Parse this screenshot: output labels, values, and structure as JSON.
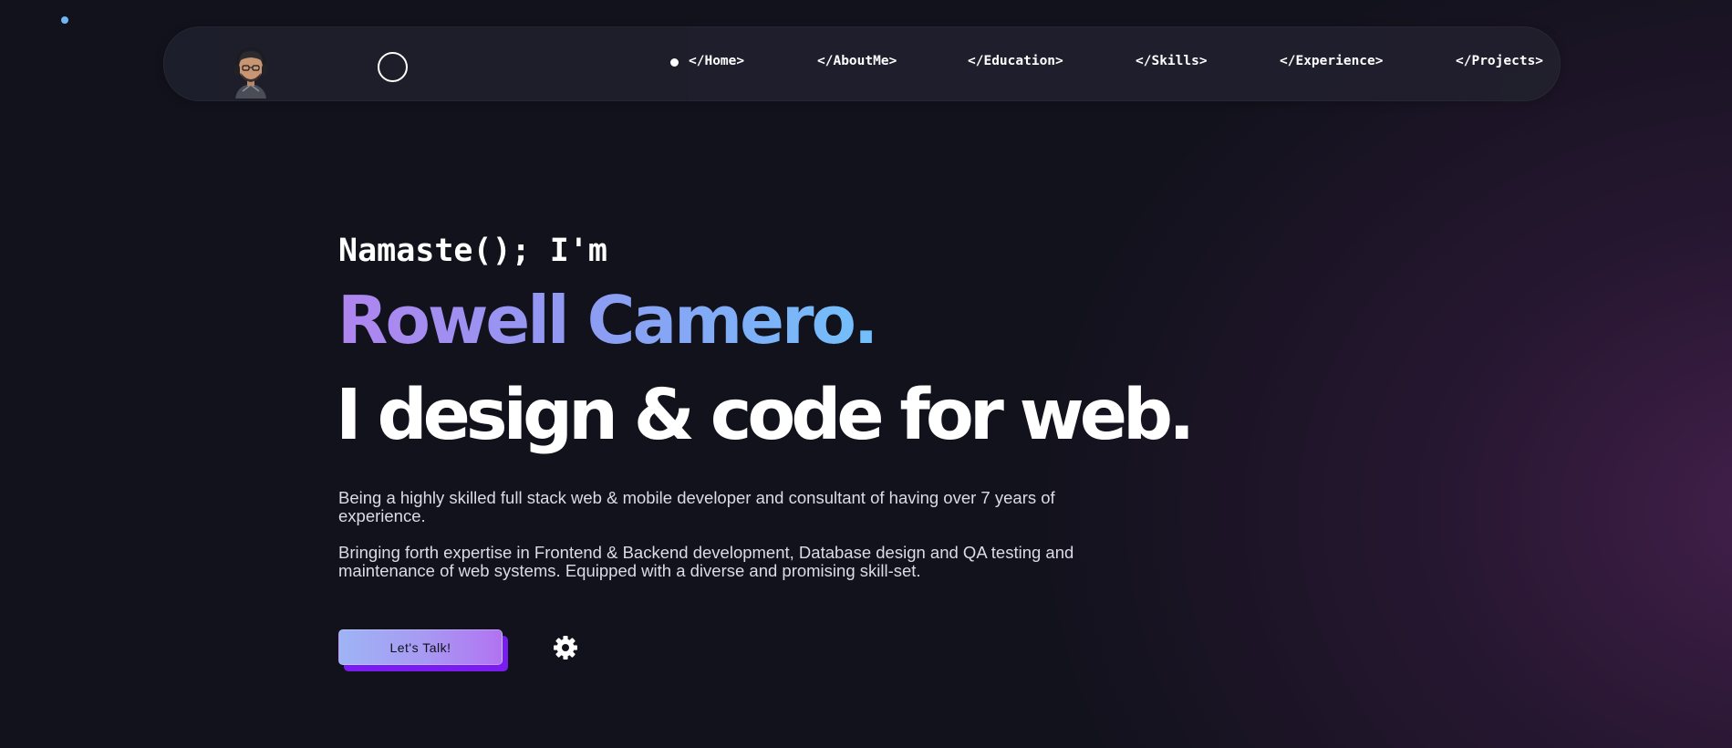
{
  "nav": {
    "items": [
      {
        "label": "</Home>",
        "active": true
      },
      {
        "label": "</AboutMe>"
      },
      {
        "label": "</Education>"
      },
      {
        "label": "</Skills>"
      },
      {
        "label": "</Experience>"
      },
      {
        "label": "</Projects>"
      }
    ],
    "icons": {
      "avatar": "avatar-icon",
      "theme_toggle": "circle-outline-icon"
    }
  },
  "hero": {
    "greeting": "Namaste(); I'm",
    "name": "Rowell Camero.",
    "tagline": "I design & code for web.",
    "bio_1": "Being a highly skilled full stack web & mobile developer and consultant of having over 7 years of experience.",
    "bio_2": "Bringing forth expertise in Frontend & Backend development, Database design and QA testing and maintenance of web systems. Equipped with a diverse and promising skill-set.",
    "cta_label": "Let's Talk!",
    "settings_icon": "gear-icon"
  },
  "colors": {
    "background": "#12121c",
    "name_gradient_start": "#b084ef",
    "name_gradient_end": "#72c0fb",
    "button_gradient_start": "#9eb4f4",
    "button_gradient_end": "#b173f1",
    "button_shadow": "#7a1cf0",
    "cursor_dot": "#6fb6f5"
  }
}
